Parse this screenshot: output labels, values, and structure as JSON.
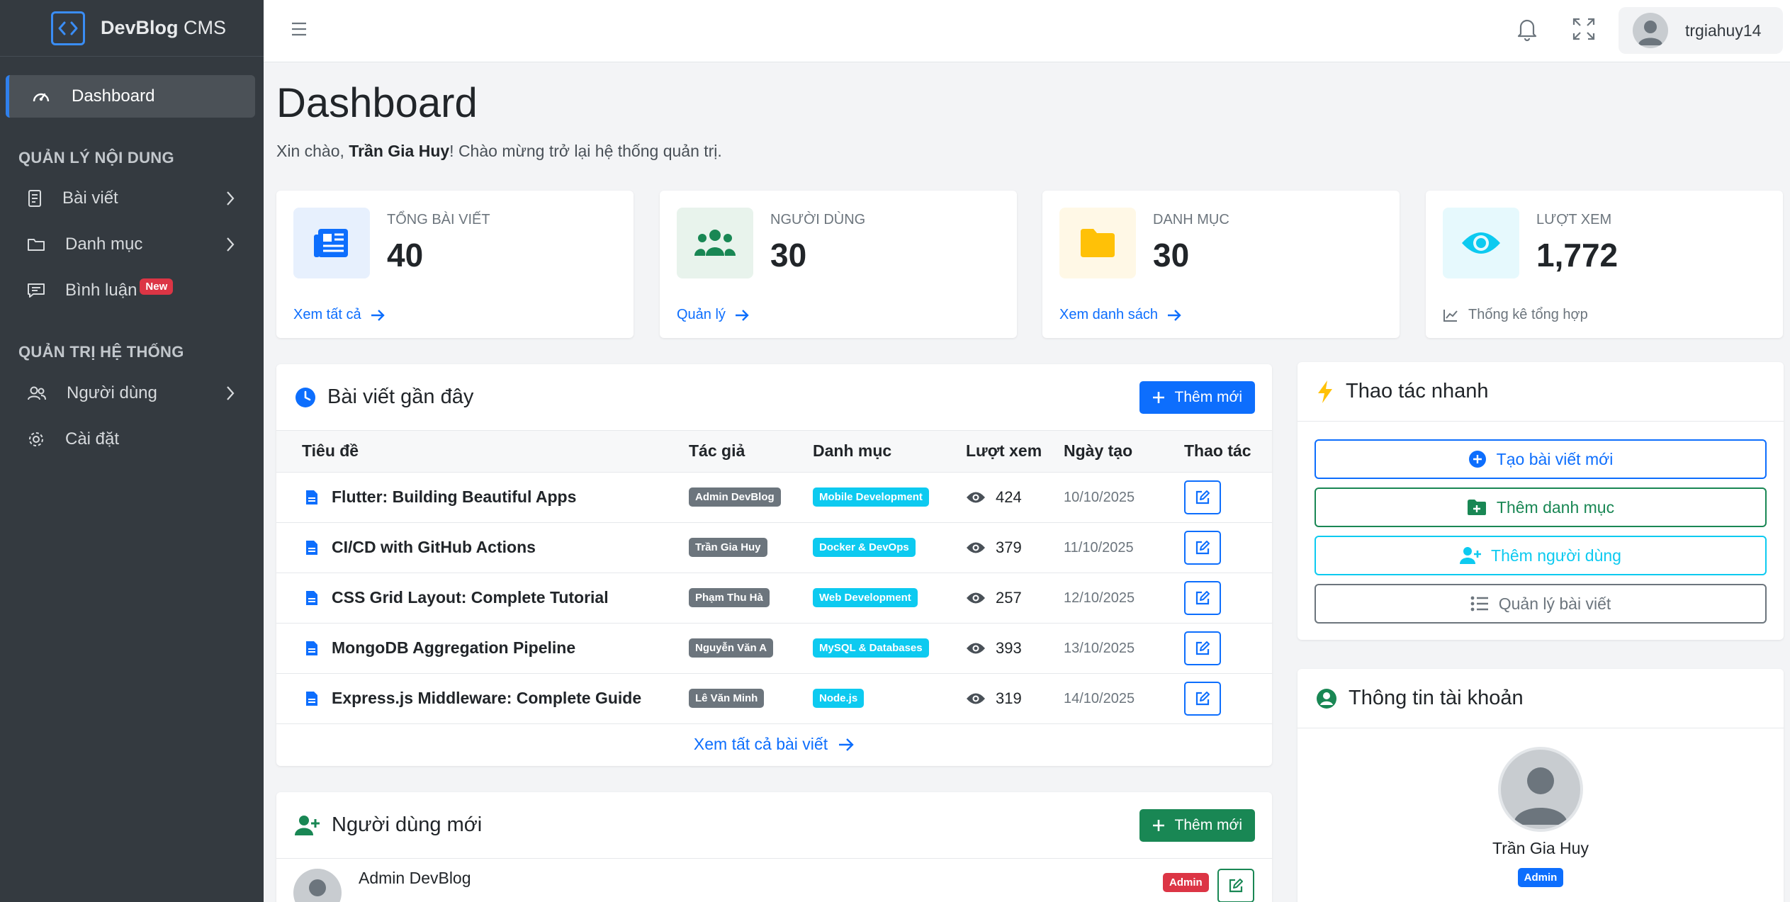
{
  "brand": {
    "name_bold": "DevBlog",
    "name_rest": " CMS"
  },
  "sidebar": {
    "active": "Dashboard",
    "section1": "QUẢN LÝ NỘI DUNG",
    "section2": "QUẢN TRỊ HỆ THỐNG",
    "items": [
      {
        "label": "Bài viết"
      },
      {
        "label": "Danh mục"
      },
      {
        "label": "Bình luận",
        "badge": "New"
      },
      {
        "label": "Người dùng"
      },
      {
        "label": "Cài đặt"
      }
    ]
  },
  "topbar": {
    "username": "trgiahuy14"
  },
  "page": {
    "title": "Dashboard",
    "greet_pre": "Xin chào, ",
    "greet_name": "Trần Gia Huy",
    "greet_post": "! Chào mừng trở lại hệ thống quản trị."
  },
  "stats": [
    {
      "label": "TỔNG BÀI VIẾT",
      "value": "40",
      "link": "Xem tất cả",
      "color": "#0d6efd",
      "bg": "#e7f0fd"
    },
    {
      "label": "NGƯỜI DÙNG",
      "value": "30",
      "link": "Quản lý",
      "color": "#198754",
      "bg": "#e8f3ec"
    },
    {
      "label": "DANH MỤC",
      "value": "30",
      "link": "Xem danh sách",
      "color": "#ffc107",
      "bg": "#fff8e6"
    },
    {
      "label": "LƯỢT XEM",
      "value": "1,772",
      "link": "Thống kê tổng hợp",
      "color": "#0dcaf0",
      "bg": "#e6f9fd"
    }
  ],
  "recent_posts": {
    "title": "Bài viết gần đây",
    "add_label": "Thêm mới",
    "columns": [
      "Tiêu đề",
      "Tác giả",
      "Danh mục",
      "Lượt xem",
      "Ngày tạo",
      "Thao tác"
    ],
    "rows": [
      {
        "title": "Flutter: Building Beautiful Apps",
        "author": "Admin DevBlog",
        "category": "Mobile Development",
        "views": "424",
        "date": "10/10/2025"
      },
      {
        "title": "CI/CD with GitHub Actions",
        "author": "Trần Gia Huy",
        "category": "Docker & DevOps",
        "views": "379",
        "date": "11/10/2025"
      },
      {
        "title": "CSS Grid Layout: Complete Tutorial",
        "author": "Phạm Thu Hà",
        "category": "Web Development",
        "views": "257",
        "date": "12/10/2025"
      },
      {
        "title": "MongoDB Aggregation Pipeline",
        "author": "Nguyễn Văn A",
        "category": "MySQL & Databases",
        "views": "393",
        "date": "13/10/2025"
      },
      {
        "title": "Express.js Middleware: Complete Guide",
        "author": "Lê Văn Minh",
        "category": "Node.js",
        "views": "319",
        "date": "14/10/2025"
      }
    ],
    "view_all": "Xem tất cả bài viết"
  },
  "new_users": {
    "title": "Người dùng mới",
    "add_label": "Thêm mới",
    "first_user": {
      "name": "Admin DevBlog",
      "role": "Admin"
    }
  },
  "quick_actions": {
    "title": "Thao tác nhanh",
    "buttons": [
      {
        "label": "Tạo bài viết mới",
        "color": "#0d6efd"
      },
      {
        "label": "Thêm danh mục",
        "color": "#198754"
      },
      {
        "label": "Thêm người dùng",
        "color": "#0dcaf0"
      },
      {
        "label": "Quản lý bài viết",
        "color": "#6c757d"
      }
    ]
  },
  "account": {
    "title": "Thông tin tài khoản",
    "name": "Trần Gia Huy",
    "role": "Admin"
  }
}
